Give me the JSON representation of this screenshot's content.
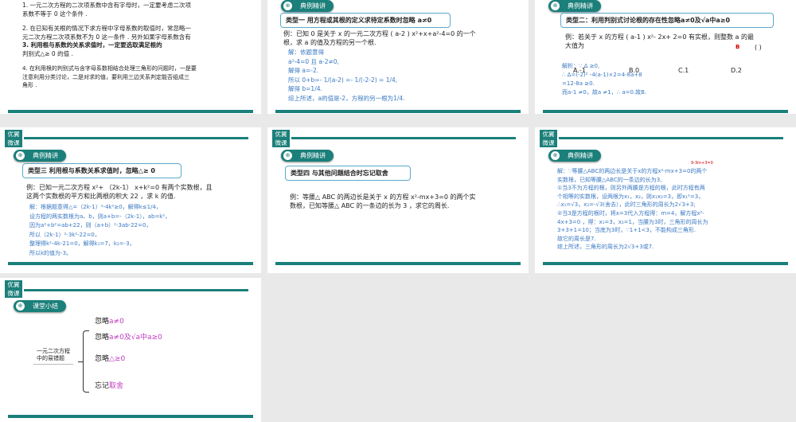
{
  "logo": "优翼微课",
  "badge_example": "典例精讲",
  "slides": [
    {
      "lines": [
        "1. 一元二次方程的二次项系数中含有字母时，一定要考虑二次项",
        "   系数不等于 0 这个条件 .",
        "",
        "2. 在已知有关根的情况下求方程中字母系数的取值时，常忽略一",
        "   元二次方程二次项系数不为 0 这一条件 . 另外如果字母系数含有",
        "3. 利用根与系数的关系求值时，一定要选取满足根的",
        "   判别式△≥ 0 的值 .",
        "",
        "4. 在利用根的判别式与含字母系数相结合处理三角形的问题时，一是要",
        "   注意利用分类讨论，二是对求的值，要利用三边关系判定能否组成三",
        "   角形 ."
      ]
    },
    {
      "title": "类型一  用方程或其根的定义求待定系数时忽略 a≠0",
      "question": [
        "例：已知 0 是关于 x 的一元二次方程 ( a-2 ) x²+x+a²-4=0 的一个",
        "根，求 a 的值及方程的另一个根."
      ],
      "solution": [
        "解：依题意得",
        "a²-4=0 且 a-2≠0,",
        "解得 a=-2.",
        "所以 0+b=- 1/(a-2) =- 1/(-2-2) = 1/4,",
        "解得 b=1/4.",
        "综上所述，a的值是-2，方程的另一根为1/4."
      ]
    },
    {
      "title": "类型二：利用判别式讨论根的存在性忽略a≠0及√a中a≥0",
      "question": [
        "例：若关于 x 的方程 ( a-1 ) x²- 2x+ 2=0 有实根，则整数 a 的最",
        "大值为"
      ],
      "answer": "B",
      "paren": "(   )",
      "options": [
        "A.-1",
        "B.0",
        "C.1",
        "D.2"
      ],
      "solution": [
        "解析：∵ Δ ≥0,",
        "∴ Δ=(-2)² -4(a-1)×2=4-8a+8",
        "     =12-8a ≥0.",
        "而a-1 ≠0，故a ≠1，∴ a=0.故B."
      ]
    },
    {
      "title": "类型三 利用根与系数关系求值时，忽略△≥ 0",
      "question": [
        "例：已知一元二次方程 x²+ （2k-1） x+k²=0 有两个实数根，且",
        "这两个实数根的平方和比两根的积大 22 ，求 k 的值."
      ],
      "solution": [
        "解：根据题意得△=（2k-1）²-4k²≥0，解得k≤1/4，",
        "设方程的两实数根为a、b，则a+b=-（2k-1），ab=k²，",
        "因为a²+b²=ab+22，则（a+b）²-3ab-22=0，",
        "所以（2k-1）²-3k²-22=0，",
        "整理得k²-4k-21=0，解得k₁=7，k₂=-3，",
        "所以k的值为-3。"
      ]
    },
    {
      "title": "类型四 与其他问题结合时忘记取舍",
      "question": [
        "例：等腰△ ABC 的两边长是关于 x 的方程 x²-mx+3=0 的两个实",
        "数根，已知等腰△ ABC 的一条边的长为 3 ，求它的周长."
      ]
    },
    {
      "annotation": "9-3m+3=0",
      "solution": [
        "解：∵等腰△ABC的两边长是关于x的方程x²-mx+3=0的两个",
        "实数根，已知等腰△ABC的一条边的长为3,",
        "①当3不为方程的根，则另外两腰是方程的根，此时方程有两",
        "个相等的实数根，设两根为x₁，x₂，则x₁x₂=3，即x₁²=3，",
        "∴x₁=√3，x₂=-√3(舍去），此时三角形的周长为2√3+3;",
        "②当3是方程的根时，将x=3代入方程得：m=4，解方程x²-",
        "4x+3=0 ，得：x₁=3，x₂=1，当腰为3时，三角形的周长为",
        "3+3+1=10；当底为3时，∵1+1<3，不能构成三角形.",
        "故它的周长是7.",
        "综上所述，三角形的周长为2√3+3或7."
      ]
    },
    {
      "badge": "课堂小结",
      "root": [
        "一元二次方程",
        "中的易错题"
      ],
      "branches": [
        {
          "prefix": "忽略",
          "highlight": "a≠0"
        },
        {
          "prefix": "忽略",
          "highlight": "a≠0及√a中a≥0"
        },
        {
          "prefix": "忽略",
          "highlight": "△≥0"
        },
        {
          "prefix": "忘记",
          "highlight": "取舍"
        }
      ]
    }
  ]
}
